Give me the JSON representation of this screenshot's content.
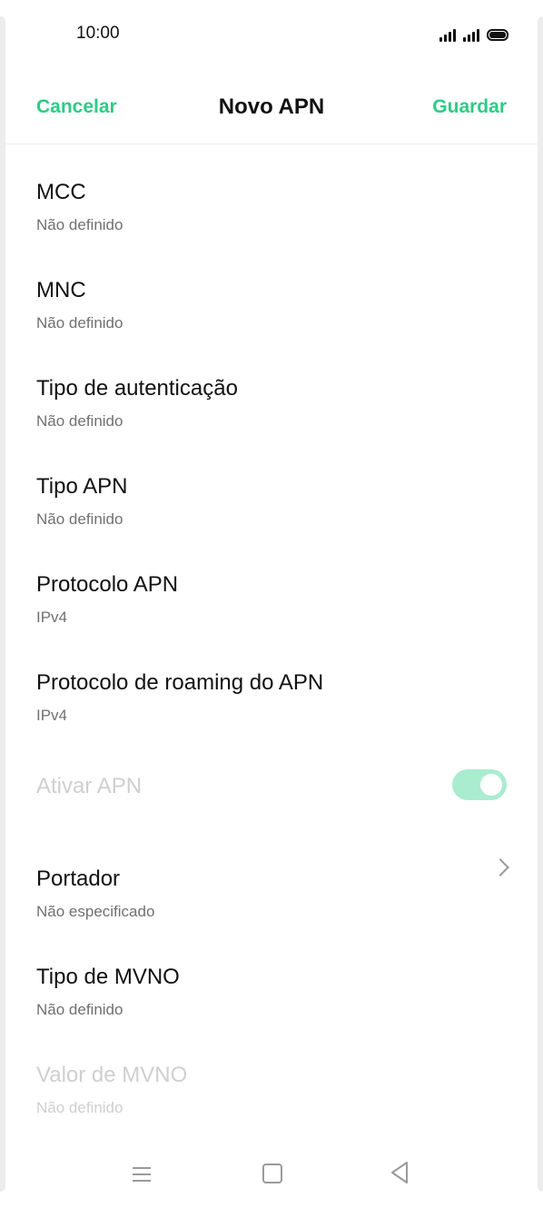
{
  "status_bar": {
    "time": "10:00"
  },
  "header": {
    "cancel_label": "Cancelar",
    "title": "Novo APN",
    "save_label": "Guardar"
  },
  "settings": [
    {
      "title": "MCC",
      "value": "Não definido",
      "enabled": true
    },
    {
      "title": "MNC",
      "value": "Não definido",
      "enabled": true
    },
    {
      "title": "Tipo de autenticação",
      "value": "Não definido",
      "enabled": true
    },
    {
      "title": "Tipo APN",
      "value": "Não definido",
      "enabled": true
    },
    {
      "title": "Protocolo APN",
      "value": "IPv4",
      "enabled": true
    },
    {
      "title": "Protocolo de roaming do APN",
      "value": "IPv4",
      "enabled": true
    },
    {
      "title": "Ativar APN",
      "enabled": false,
      "toggle_on": true
    },
    {
      "title": "Portador",
      "value": "Não especificado",
      "enabled": true
    },
    {
      "title": "Tipo de MVNO",
      "value": "Não definido",
      "enabled": true
    },
    {
      "title": "Valor de MVNO",
      "value": "Não definido",
      "enabled": false
    }
  ],
  "colors": {
    "accent": "#2ecb85",
    "toggle_track": "#a9ecd0",
    "disabled_text": "#cfcfcf",
    "secondary_text": "#707070"
  },
  "icons": {
    "signal": "signal-icon",
    "battery": "battery-icon",
    "chevron": "chevron-right-icon",
    "menu": "menu-icon",
    "home": "home-icon",
    "back": "back-icon"
  }
}
